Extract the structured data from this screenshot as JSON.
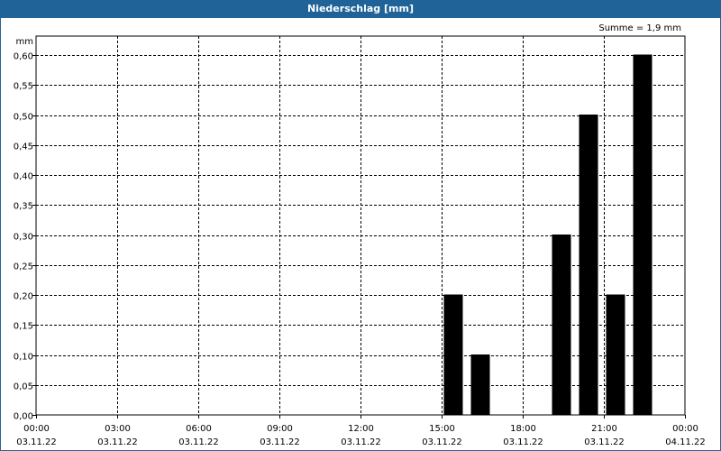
{
  "window": {
    "title": "Niederschlag [mm]"
  },
  "chart_data": {
    "type": "bar",
    "title": "Niederschlag [mm]",
    "ylabel": "mm",
    "annotation": "Summe = 1,9 mm",
    "ylim": [
      0,
      0.63
    ],
    "yticks": [
      "0,00",
      "0,05",
      "0,10",
      "0,15",
      "0,20",
      "0,25",
      "0,30",
      "0,35",
      "0,40",
      "0,45",
      "0,50",
      "0,55",
      "0,60"
    ],
    "xticks": [
      {
        "time": "00:00",
        "date": "03.11.22"
      },
      {
        "time": "03:00",
        "date": "03.11.22"
      },
      {
        "time": "06:00",
        "date": "03.11.22"
      },
      {
        "time": "09:00",
        "date": "03.11.22"
      },
      {
        "time": "12:00",
        "date": "03.11.22"
      },
      {
        "time": "15:00",
        "date": "03.11.22"
      },
      {
        "time": "18:00",
        "date": "03.11.22"
      },
      {
        "time": "21:00",
        "date": "03.11.22"
      },
      {
        "time": "00:00",
        "date": "04.11.22"
      }
    ],
    "xlim_hours": [
      0,
      24
    ],
    "grid": true,
    "bar_color": "#000000",
    "series": [
      {
        "values": [
          {
            "hour": 15,
            "value": 0.2
          },
          {
            "hour": 16,
            "value": 0.1
          },
          {
            "hour": 19,
            "value": 0.3
          },
          {
            "hour": 20,
            "value": 0.5
          },
          {
            "hour": 21,
            "value": 0.2
          },
          {
            "hour": 22,
            "value": 0.6
          }
        ]
      }
    ]
  }
}
